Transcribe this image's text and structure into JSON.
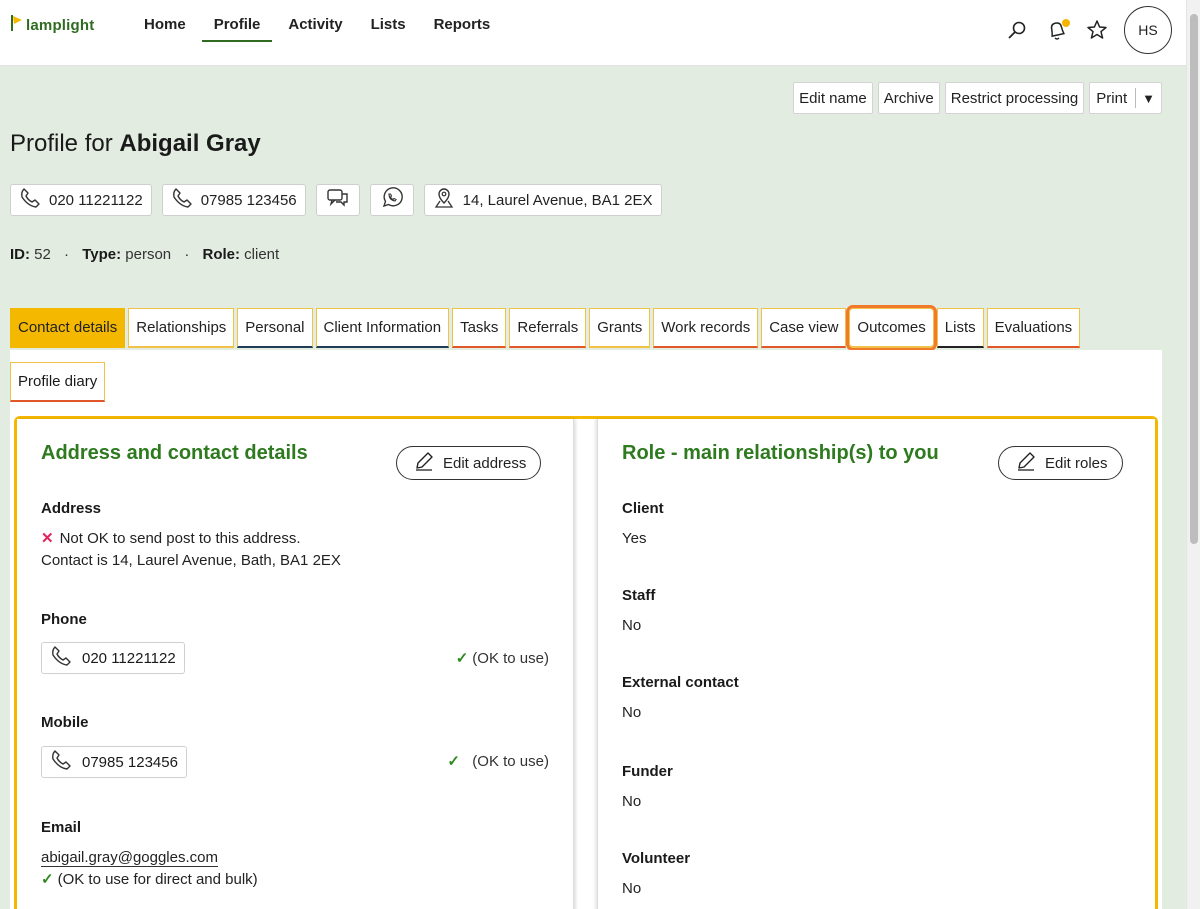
{
  "logo": {
    "text": "lamplight"
  },
  "nav": {
    "items": [
      {
        "label": "Home",
        "active": false
      },
      {
        "label": "Profile",
        "active": true
      },
      {
        "label": "Activity",
        "active": false
      },
      {
        "label": "Lists",
        "active": false
      },
      {
        "label": "Reports",
        "active": false
      }
    ],
    "avatar_initials": "HS"
  },
  "actions": {
    "edit_name": "Edit name",
    "archive": "Archive",
    "restrict": "Restrict processing",
    "print": "Print",
    "print_arrow": "▼"
  },
  "profile": {
    "title_prefix": "Profile for",
    "name": "Abigail Gray",
    "phone": "020 11221122",
    "mobile": "07985 123456",
    "address_short": "14, Laurel Avenue, BA1 2EX"
  },
  "meta": {
    "id_label": "ID:",
    "id_value": "52",
    "type_label": "Type:",
    "type_value": "person",
    "role_label": "Role:",
    "role_value": "client"
  },
  "tabs": [
    {
      "label": "Contact details",
      "active": true
    },
    {
      "label": "Relationships"
    },
    {
      "label": "Personal"
    },
    {
      "label": "Client Information"
    },
    {
      "label": "Tasks"
    },
    {
      "label": "Referrals"
    },
    {
      "label": "Grants"
    },
    {
      "label": "Work records"
    },
    {
      "label": "Case view"
    },
    {
      "label": "Outcomes"
    },
    {
      "label": "Lists"
    },
    {
      "label": "Evaluations"
    }
  ],
  "tab_row2": {
    "label": "Profile diary"
  },
  "left_panel": {
    "title": "Address and contact details",
    "edit_label": "Edit address",
    "address_label": "Address",
    "address_warning": "Not OK to send post to this address.",
    "address_full": "Contact is 14, Laurel Avenue, Bath, BA1 2EX",
    "phone_label": "Phone",
    "phone_value": "020 11221122",
    "phone_ok": "(OK to use)",
    "mobile_label": "Mobile",
    "mobile_value": "07985 123456",
    "mobile_ok": "(OK to use)",
    "email_label": "Email",
    "email_value": "abigail.gray@goggles.com",
    "email_ok": "(OK to use for direct and bulk)"
  },
  "right_panel": {
    "title": "Role - main relationship(s) to you",
    "edit_label": "Edit roles",
    "roles": [
      {
        "label": "Client",
        "value": "Yes"
      },
      {
        "label": "Staff",
        "value": "No"
      },
      {
        "label": "External contact",
        "value": "No"
      },
      {
        "label": "Funder",
        "value": "No"
      },
      {
        "label": "Volunteer",
        "value": "No"
      }
    ]
  },
  "colors": {
    "brand_green": "#2d7a1f",
    "tab_active": "#f5b800",
    "highlight": "#f07a2a",
    "background": "#e2ece1"
  }
}
